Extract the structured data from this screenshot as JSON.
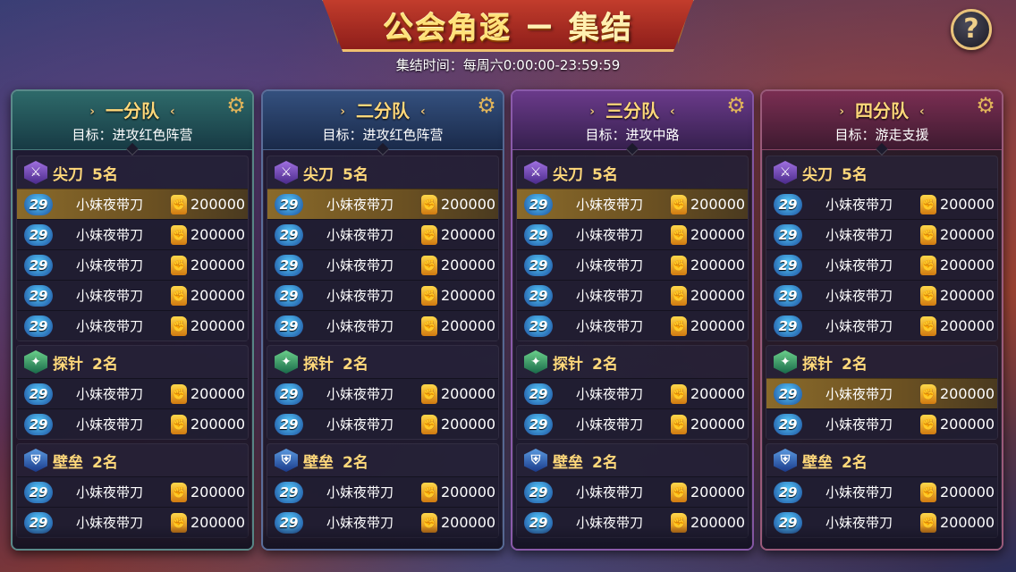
{
  "header": {
    "title_main": "公会角逐",
    "title_sep": "－",
    "title_sub": "集结",
    "time_text": "集结时间：每周六0:00:00-23:59:59",
    "help_label": "?"
  },
  "icons": {
    "gear": "gear-icon",
    "blade_role": "crossed-swords-icon",
    "probe_role": "compass-icon",
    "wall_role": "shield-icon",
    "power": "fist-icon",
    "level_badge": "level-badge-icon"
  },
  "colors": {
    "title_gold": "#ffe27a",
    "team_name_gold": "#ffd87a",
    "highlight_row": "#8a6a2a"
  },
  "teams": [
    {
      "name": "一分队",
      "target": "目标：进攻红色阵营",
      "groups": [
        {
          "role": "尖刀",
          "count": "5名",
          "members": [
            {
              "level": "29",
              "name": "小妹夜带刀",
              "power": "200000"
            },
            {
              "level": "29",
              "name": "小妹夜带刀",
              "power": "200000"
            },
            {
              "level": "29",
              "name": "小妹夜带刀",
              "power": "200000"
            },
            {
              "level": "29",
              "name": "小妹夜带刀",
              "power": "200000"
            },
            {
              "level": "29",
              "name": "小妹夜带刀",
              "power": "200000"
            }
          ]
        },
        {
          "role": "探针",
          "count": "2名",
          "members": [
            {
              "level": "29",
              "name": "小妹夜带刀",
              "power": "200000"
            },
            {
              "level": "29",
              "name": "小妹夜带刀",
              "power": "200000"
            }
          ]
        },
        {
          "role": "壁垒",
          "count": "2名",
          "members": [
            {
              "level": "29",
              "name": "小妹夜带刀",
              "power": "200000"
            },
            {
              "level": "29",
              "name": "小妹夜带刀",
              "power": "200000"
            }
          ]
        }
      ]
    },
    {
      "name": "二分队",
      "target": "目标：进攻红色阵营",
      "groups": [
        {
          "role": "尖刀",
          "count": "5名",
          "members": [
            {
              "level": "29",
              "name": "小妹夜带刀",
              "power": "200000"
            },
            {
              "level": "29",
              "name": "小妹夜带刀",
              "power": "200000"
            },
            {
              "level": "29",
              "name": "小妹夜带刀",
              "power": "200000"
            },
            {
              "level": "29",
              "name": "小妹夜带刀",
              "power": "200000"
            },
            {
              "level": "29",
              "name": "小妹夜带刀",
              "power": "200000"
            }
          ]
        },
        {
          "role": "探针",
          "count": "2名",
          "members": [
            {
              "level": "29",
              "name": "小妹夜带刀",
              "power": "200000"
            },
            {
              "level": "29",
              "name": "小妹夜带刀",
              "power": "200000"
            }
          ]
        },
        {
          "role": "壁垒",
          "count": "2名",
          "members": [
            {
              "level": "29",
              "name": "小妹夜带刀",
              "power": "200000"
            },
            {
              "level": "29",
              "name": "小妹夜带刀",
              "power": "200000"
            }
          ]
        }
      ]
    },
    {
      "name": "三分队",
      "target": "目标：进攻中路",
      "groups": [
        {
          "role": "尖刀",
          "count": "5名",
          "members": [
            {
              "level": "29",
              "name": "小妹夜带刀",
              "power": "200000"
            },
            {
              "level": "29",
              "name": "小妹夜带刀",
              "power": "200000"
            },
            {
              "level": "29",
              "name": "小妹夜带刀",
              "power": "200000"
            },
            {
              "level": "29",
              "name": "小妹夜带刀",
              "power": "200000"
            },
            {
              "level": "29",
              "name": "小妹夜带刀",
              "power": "200000"
            }
          ]
        },
        {
          "role": "探针",
          "count": "2名",
          "members": [
            {
              "level": "29",
              "name": "小妹夜带刀",
              "power": "200000"
            },
            {
              "level": "29",
              "name": "小妹夜带刀",
              "power": "200000"
            }
          ]
        },
        {
          "role": "壁垒",
          "count": "2名",
          "members": [
            {
              "level": "29",
              "name": "小妹夜带刀",
              "power": "200000"
            },
            {
              "level": "29",
              "name": "小妹夜带刀",
              "power": "200000"
            }
          ]
        }
      ]
    },
    {
      "name": "四分队",
      "target": "目标：游走支援",
      "groups": [
        {
          "role": "尖刀",
          "count": "5名",
          "members": [
            {
              "level": "29",
              "name": "小妹夜带刀",
              "power": "200000"
            },
            {
              "level": "29",
              "name": "小妹夜带刀",
              "power": "200000"
            },
            {
              "level": "29",
              "name": "小妹夜带刀",
              "power": "200000"
            },
            {
              "level": "29",
              "name": "小妹夜带刀",
              "power": "200000"
            },
            {
              "level": "29",
              "name": "小妹夜带刀",
              "power": "200000"
            }
          ]
        },
        {
          "role": "探针",
          "count": "2名",
          "members": [
            {
              "level": "29",
              "name": "小妹夜带刀",
              "power": "200000"
            },
            {
              "level": "29",
              "name": "小妹夜带刀",
              "power": "200000"
            }
          ]
        },
        {
          "role": "壁垒",
          "count": "2名",
          "members": [
            {
              "level": "29",
              "name": "小妹夜带刀",
              "power": "200000"
            },
            {
              "level": "29",
              "name": "小妹夜带刀",
              "power": "200000"
            }
          ]
        }
      ]
    }
  ]
}
